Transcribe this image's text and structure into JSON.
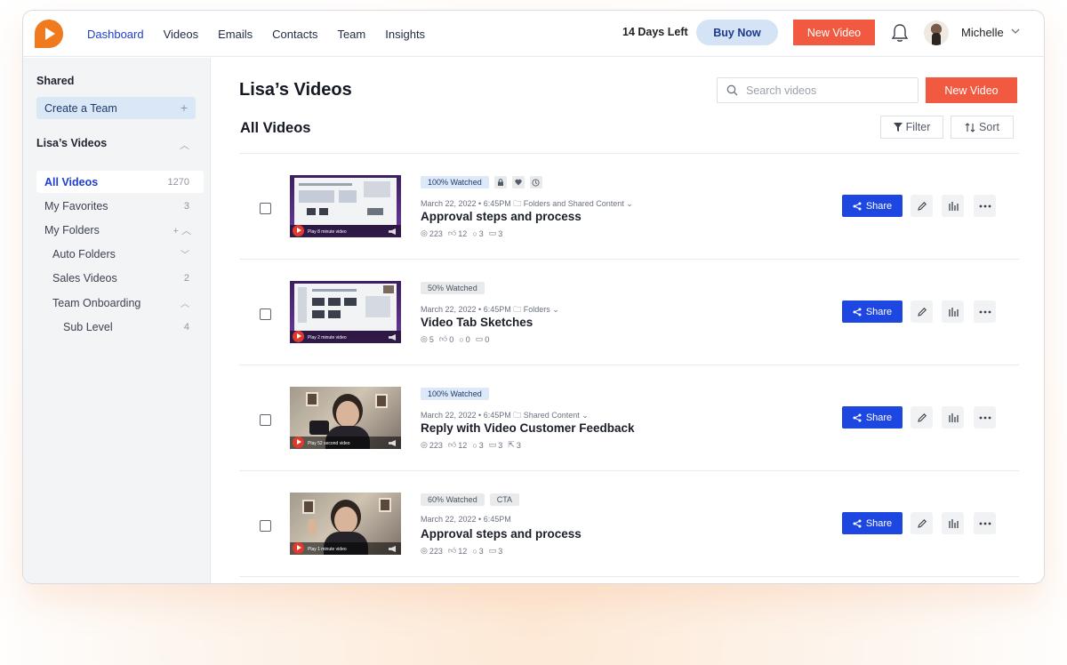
{
  "nav": {
    "items": [
      "Dashboard",
      "Videos",
      "Emails",
      "Contacts",
      "Team",
      "Insights"
    ],
    "trial_text": "14 Days Left",
    "buy_label": "Buy Now",
    "new_video_label": "New Video",
    "user_name": "Michelle",
    "accent": "#1e3ed0"
  },
  "sidebar": {
    "shared_heading": "Shared",
    "create_team_label": "Create a Team",
    "section_heading": "Lisa’s Videos",
    "items": [
      {
        "label": "All Videos",
        "count": "1270"
      },
      {
        "label": "My Favorites",
        "count": "3"
      },
      {
        "label": "My Folders",
        "count": ""
      },
      {
        "label": "Auto Folders",
        "count": ""
      },
      {
        "label": "Sales Videos",
        "count": "2"
      },
      {
        "label": "Team Onboarding",
        "count": ""
      },
      {
        "label": "Sub Level",
        "count": "4"
      }
    ]
  },
  "main": {
    "page_title": "Lisa’s Videos",
    "search_placeholder": "Search videos",
    "new_video_label": "New Video",
    "section_title": "All Videos",
    "filter_label": "Filter",
    "sort_label": "Sort",
    "share_label": "Share",
    "videos": [
      {
        "watched": "100% Watched",
        "extra_tag": "",
        "meta": "March 22, 2022 • 6:45PM 🗀 Folders and Shared Content ⌄",
        "title": "Approval steps and process",
        "views": "223",
        "likes": "12",
        "comments": "3",
        "replies": "3",
        "ctas": "",
        "thumb_caption": "Play 8 minute video"
      },
      {
        "watched": "50% Watched",
        "extra_tag": "",
        "meta": "March 22, 2022 • 6:45PM 🗀 Folders ⌄",
        "title": "Video Tab Sketches",
        "views": "5",
        "likes": "0",
        "comments": "0",
        "replies": "0",
        "ctas": "",
        "thumb_caption": "Play 2 minute video"
      },
      {
        "watched": "100% Watched",
        "extra_tag": "",
        "meta": "March 22, 2022 • 6:45PM 🗀 Shared Content ⌄",
        "title": "Reply with Video Customer Feedback",
        "views": "223",
        "likes": "12",
        "comments": "3",
        "replies": "3",
        "ctas": "3",
        "thumb_caption": "Play 52 second video"
      },
      {
        "watched": "60% Watched",
        "extra_tag": "CTA",
        "meta": "March 22, 2022 • 6:45PM",
        "title": "Approval steps and process",
        "views": "223",
        "likes": "12",
        "comments": "3",
        "replies": "3",
        "ctas": "",
        "thumb_caption": "Play 1 minute video"
      }
    ]
  }
}
